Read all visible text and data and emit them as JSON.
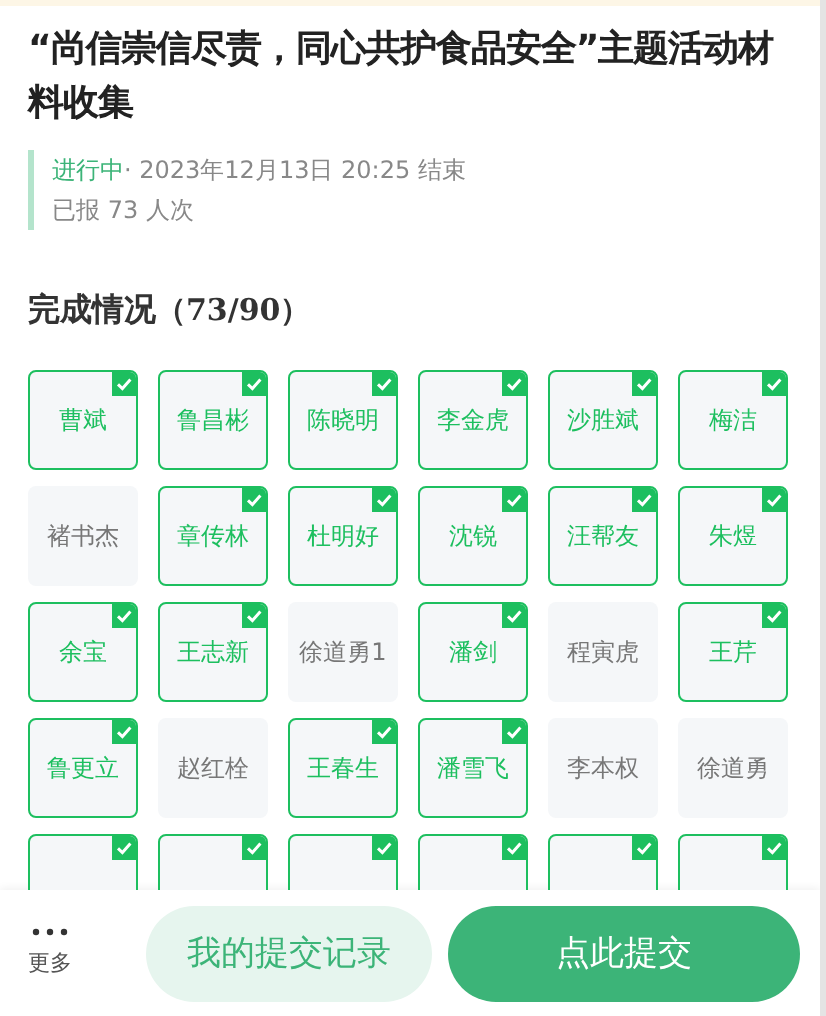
{
  "title": "“尚信崇信尽责，同心共护食品安全”主题活动材料收集",
  "status": "进行中",
  "deadline": "· 2023年12月13日 20:25 结束",
  "reported": "已报 73 人次",
  "section": {
    "label": "完成情况",
    "count": "（73/90）"
  },
  "members": [
    {
      "name": "曹斌",
      "checked": true
    },
    {
      "name": "鲁昌彬",
      "checked": true
    },
    {
      "name": "陈晓明",
      "checked": true
    },
    {
      "name": "李金虎",
      "checked": true
    },
    {
      "name": "沙胜斌",
      "checked": true
    },
    {
      "name": "梅洁",
      "checked": true
    },
    {
      "name": "褚书杰",
      "checked": false
    },
    {
      "name": "章传林",
      "checked": true
    },
    {
      "name": "杜明好",
      "checked": true
    },
    {
      "name": "沈锐",
      "checked": true
    },
    {
      "name": "汪帮友",
      "checked": true
    },
    {
      "name": "朱煜",
      "checked": true
    },
    {
      "name": "余宝",
      "checked": true
    },
    {
      "name": "王志新",
      "checked": true
    },
    {
      "name": "徐道勇1",
      "checked": false
    },
    {
      "name": "潘剑",
      "checked": true
    },
    {
      "name": "程寅虎",
      "checked": false
    },
    {
      "name": "王芹",
      "checked": true
    },
    {
      "name": "鲁更立",
      "checked": true
    },
    {
      "name": "赵红栓",
      "checked": false
    },
    {
      "name": "王春生",
      "checked": true
    },
    {
      "name": "潘雪飞",
      "checked": true
    },
    {
      "name": "李本权",
      "checked": false
    },
    {
      "name": "徐道勇",
      "checked": false
    },
    {
      "checked": true
    },
    {
      "checked": true
    },
    {
      "checked": true
    },
    {
      "checked": true
    },
    {
      "checked": true
    },
    {
      "checked": true
    }
  ],
  "more": "更多",
  "buttons": [
    {
      "label": "我的提交记录",
      "kind": "secondary"
    },
    {
      "label": "点此提交",
      "kind": "primary"
    }
  ]
}
